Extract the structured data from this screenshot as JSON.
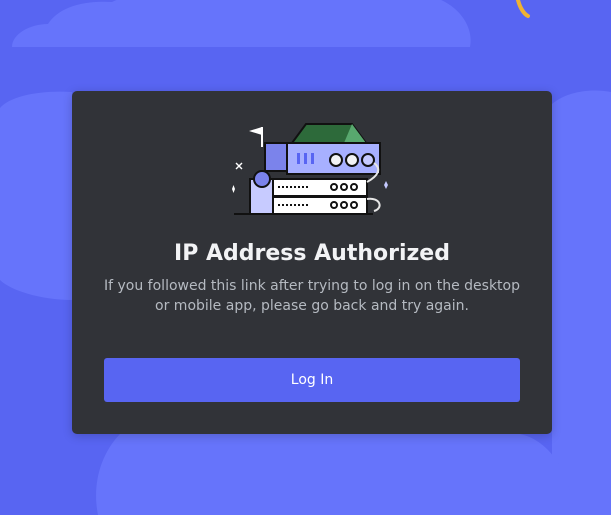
{
  "colors": {
    "background": "#5865f2",
    "cloud": "#6674fb",
    "card": "#313338",
    "button": "#5865f2",
    "title": "#f2f3f5",
    "subtitle": "#b5bac1"
  },
  "illustration": {
    "icon": "server-stack-icon"
  },
  "auth": {
    "title": "IP Address Authorized",
    "message": "If you followed this link after trying to log in on the desktop or mobile app, please go back and try again.",
    "button_label": "Log In"
  }
}
